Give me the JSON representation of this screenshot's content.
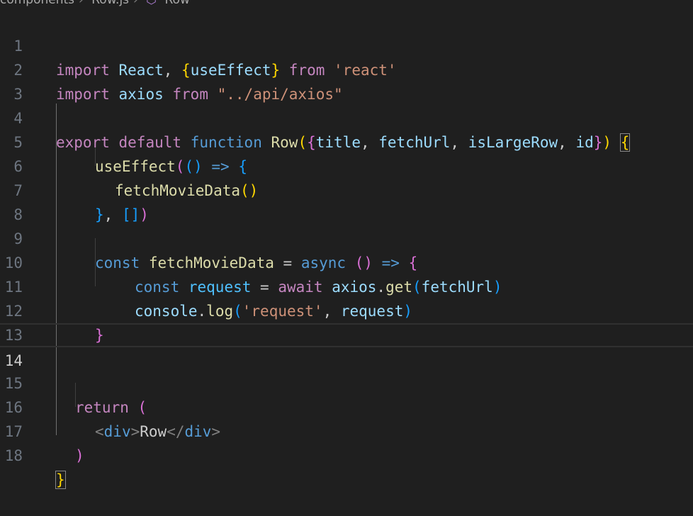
{
  "breadcrumb": {
    "parts": [
      "components",
      "Row.js",
      "Row"
    ]
  },
  "editor": {
    "current_line": 14,
    "lines": [
      {
        "n": "1"
      },
      {
        "n": "2"
      },
      {
        "n": "3"
      },
      {
        "n": "4"
      },
      {
        "n": "5"
      },
      {
        "n": "6"
      },
      {
        "n": "7"
      },
      {
        "n": "8"
      },
      {
        "n": "9"
      },
      {
        "n": "10"
      },
      {
        "n": "11"
      },
      {
        "n": "12"
      },
      {
        "n": "13"
      },
      {
        "n": "14"
      },
      {
        "n": "15"
      },
      {
        "n": "16"
      },
      {
        "n": "17"
      },
      {
        "n": "18"
      }
    ],
    "tokens": {
      "l1": [
        "import",
        " ",
        "React",
        ", ",
        "{",
        "useEffect",
        "}",
        " ",
        "from",
        " ",
        "'react'"
      ],
      "l2": [
        "import",
        " ",
        "axios",
        " ",
        "from",
        " ",
        "\"../api/axios\""
      ],
      "l4": [
        "export",
        " ",
        "default",
        " ",
        "function",
        " ",
        "Row",
        "(",
        "{",
        "title",
        ", ",
        "fetchUrl",
        ", ",
        "isLargeRow",
        ", ",
        "id",
        "}",
        ")",
        " ",
        "{"
      ],
      "l5": [
        "useEffect",
        "(",
        "()",
        " ",
        "=>",
        " ",
        "{"
      ],
      "l6": [
        "fetchMovieData",
        "()"
      ],
      "l7": [
        "}",
        ", ",
        "[]",
        ")"
      ],
      "l9": [
        "const",
        " ",
        "fetchMovieData",
        " = ",
        "async",
        " ",
        "()",
        " ",
        "=>",
        " ",
        "{"
      ],
      "l10": [
        "const",
        " ",
        "request",
        " = ",
        "await",
        " ",
        "axios",
        ".",
        "get",
        "(",
        "fetchUrl",
        ")"
      ],
      "l11": [
        "console",
        ".",
        "log",
        "(",
        "'request'",
        ", ",
        "request",
        ")"
      ],
      "l12": [
        "}"
      ],
      "l15": [
        "return",
        " ",
        "("
      ],
      "l16": [
        "<",
        "div",
        ">",
        "Row",
        "</",
        "div",
        ">"
      ],
      "l17": [
        ")"
      ],
      "l18": [
        "}"
      ]
    }
  }
}
